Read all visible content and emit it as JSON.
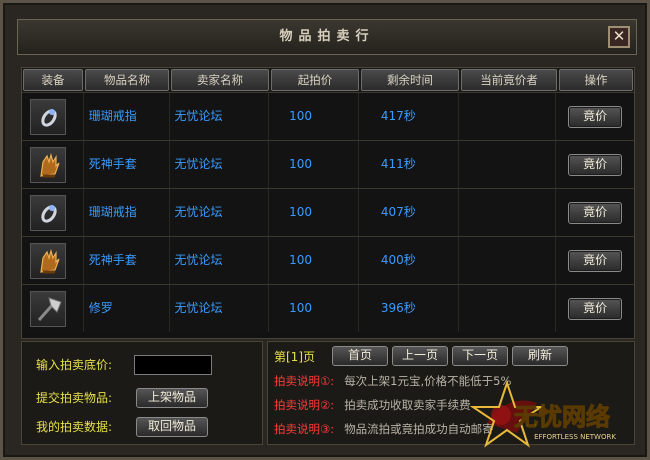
{
  "window": {
    "title": "物品拍卖行",
    "close_label": "✕"
  },
  "table": {
    "headers": [
      "装备",
      "物品名称",
      "卖家名称",
      "起拍价",
      "剩余时间",
      "当前竟价者",
      "操作"
    ],
    "rows": [
      {
        "icon": "ring-icon",
        "name": "珊瑚戒指",
        "seller": "无忧论坛",
        "price": "100",
        "time": "417秒",
        "bidder": "",
        "action": "竟价"
      },
      {
        "icon": "gauntlet-icon",
        "name": "死神手套",
        "seller": "无忧论坛",
        "price": "100",
        "time": "411秒",
        "bidder": "",
        "action": "竟价"
      },
      {
        "icon": "ring-icon",
        "name": "珊瑚戒指",
        "seller": "无忧论坛",
        "price": "100",
        "time": "407秒",
        "bidder": "",
        "action": "竟价"
      },
      {
        "icon": "gauntlet-icon",
        "name": "死神手套",
        "seller": "无忧论坛",
        "price": "100",
        "time": "400秒",
        "bidder": "",
        "action": "竟价"
      },
      {
        "icon": "axe-icon",
        "name": "修罗",
        "seller": "无忧论坛",
        "price": "100",
        "time": "396秒",
        "bidder": "",
        "action": "竟价"
      }
    ]
  },
  "controls": {
    "price_label": "输入拍卖底价:",
    "price_value": "",
    "submit_label": "提交拍卖物品:",
    "submit_button": "上架物品",
    "mydata_label": "我的拍卖数据:",
    "mydata_button": "取回物品"
  },
  "pager": {
    "page_label": "第[1]页",
    "first": "首页",
    "prev": "上一页",
    "next": "下一页",
    "refresh": "刷新"
  },
  "notes": [
    {
      "label": "拍卖说明①:",
      "text": "每次上架1元宝,价格不能低于5%"
    },
    {
      "label": "拍卖说明②:",
      "text": "拍卖成功收取卖家手续费"
    },
    {
      "label": "拍卖说明③:",
      "text": "物品流拍或竟拍成功自动邮寄"
    }
  ],
  "watermark": {
    "brand": "无忧网络",
    "sub": "EFFORTLESS NETWORK"
  },
  "colors": {
    "item_text": "#3a9bff",
    "label_yellow": "#e7e04a",
    "note_red": "#ff3b3b"
  }
}
